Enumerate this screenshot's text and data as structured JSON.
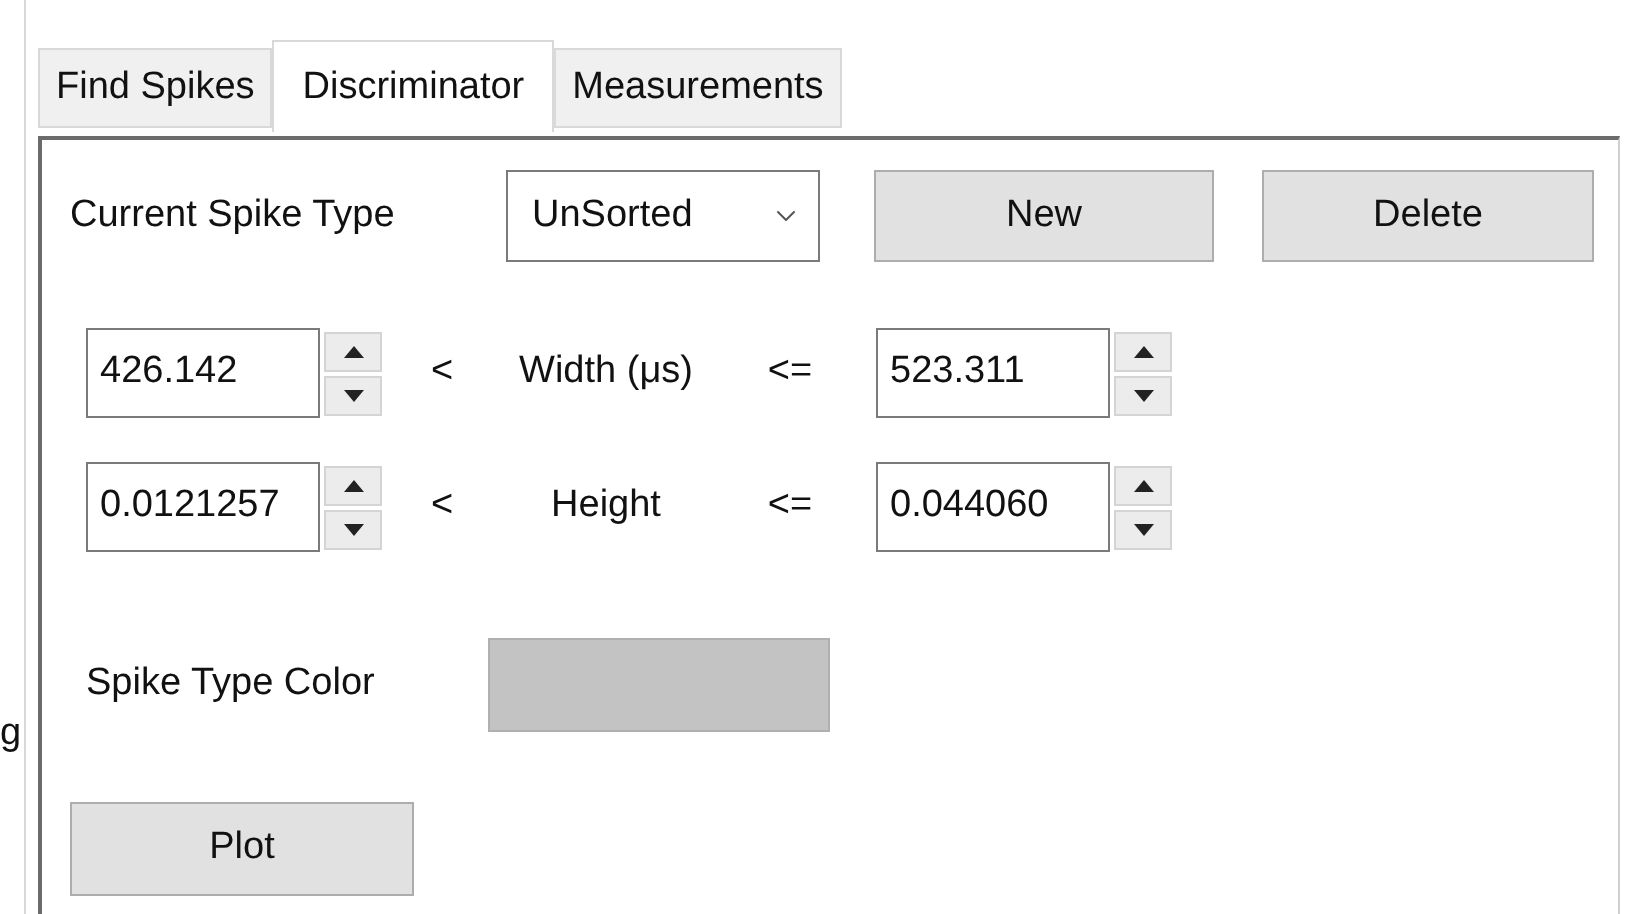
{
  "tabs": [
    {
      "label": "Find Spikes",
      "selected": false
    },
    {
      "label": "Discriminator",
      "selected": true
    },
    {
      "label": "Measurements",
      "selected": false
    }
  ],
  "left_edge_text": "g",
  "spike_type": {
    "label": "Current Spike Type",
    "value": "UnSorted"
  },
  "new_button": "New",
  "delete_button": "Delete",
  "filters": [
    {
      "min": "426.142",
      "op_min": "<",
      "label": "Width (μs)",
      "op_max": "<=",
      "max": "523.311"
    },
    {
      "min": "0.0121257",
      "op_min": "<",
      "label": "Height",
      "op_max": "<=",
      "max": "0.044060"
    }
  ],
  "spike_color": {
    "label": "Spike Type Color",
    "color": "#c3c3c3"
  },
  "plot_button": "Plot"
}
